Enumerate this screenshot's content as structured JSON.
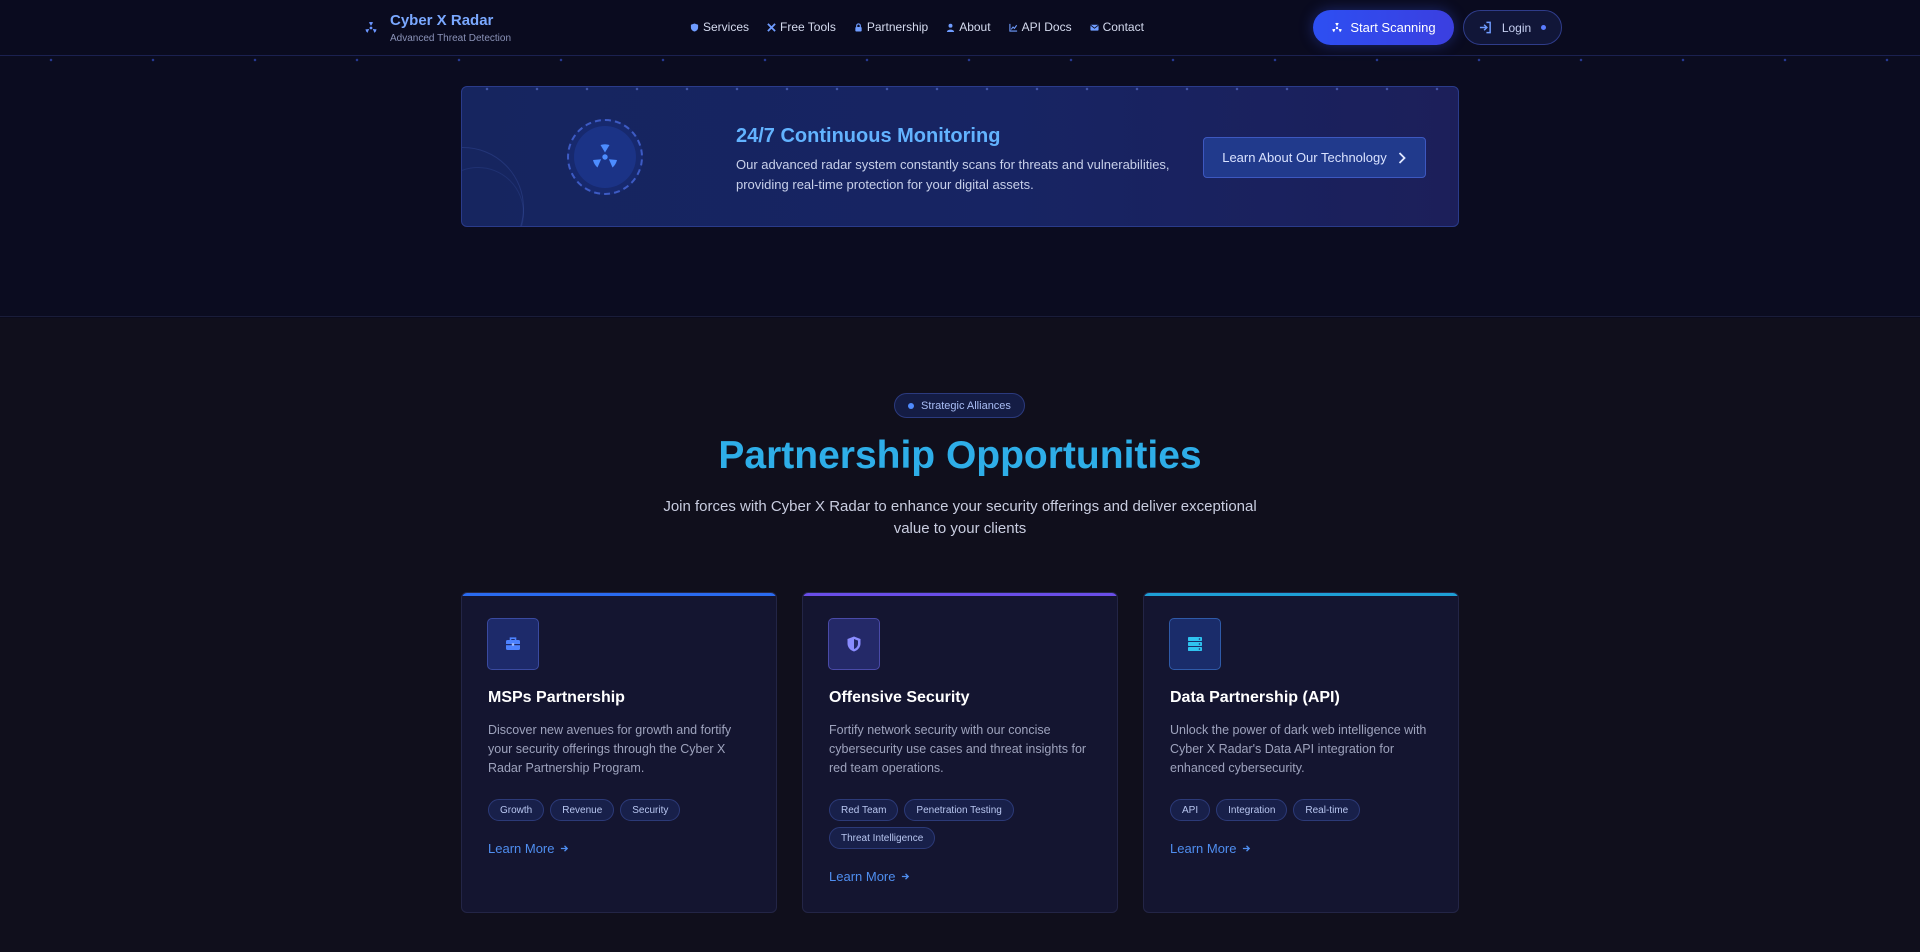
{
  "brand": {
    "title": "Cyber X Radar",
    "subtitle": "Advanced Threat Detection"
  },
  "nav": {
    "items": [
      {
        "label": "Services",
        "icon": "shield-icon"
      },
      {
        "label": "Free Tools",
        "icon": "tools-icon"
      },
      {
        "label": "Partnership",
        "icon": "lock-icon"
      },
      {
        "label": "About",
        "icon": "user-icon"
      },
      {
        "label": "API Docs",
        "icon": "chart-icon"
      },
      {
        "label": "Contact",
        "icon": "envelope-icon"
      }
    ],
    "start_scanning": "Start Scanning",
    "login": "Login"
  },
  "monitoring": {
    "title": "24/7 Continuous Monitoring",
    "description": "Our advanced radar system constantly scans for threats and vulnerabilities, providing real-time protection for your digital assets.",
    "button": "Learn About Our Technology"
  },
  "partnership": {
    "badge": "Strategic Alliances",
    "title": "Partnership Opportunities",
    "subtitle": "Join forces with Cyber X Radar to enhance your security offerings and deliver exceptional value to your clients",
    "cards": [
      {
        "title": "MSPs Partnership",
        "description": "Discover new avenues for growth and fortify your security offerings through the Cyber X Radar Partnership Program.",
        "tags": [
          "Growth",
          "Revenue",
          "Security"
        ],
        "link": "Learn More",
        "icon": "briefcase-icon",
        "accent": "#2a6bf0"
      },
      {
        "title": "Offensive Security",
        "description": "Fortify network security with our concise cybersecurity use cases and threat insights for red team operations.",
        "tags": [
          "Red Team",
          "Penetration Testing",
          "Threat Intelligence"
        ],
        "link": "Learn More",
        "icon": "shield-half-icon",
        "accent": "#6a4ee8"
      },
      {
        "title": "Data Partnership (API)",
        "description": "Unlock the power of dark web intelligence with Cyber X Radar's Data API integration for enhanced cybersecurity.",
        "tags": [
          "API",
          "Integration",
          "Real-time"
        ],
        "link": "Learn More",
        "icon": "server-icon",
        "accent": "#1e9fd6"
      }
    ]
  },
  "colors": {
    "brand": "#7aa8ff",
    "primary_button": "#2d4ff2",
    "heading_cyan": "#2eaee8",
    "link": "#4f8ef0",
    "background": "#0b0b1c"
  }
}
